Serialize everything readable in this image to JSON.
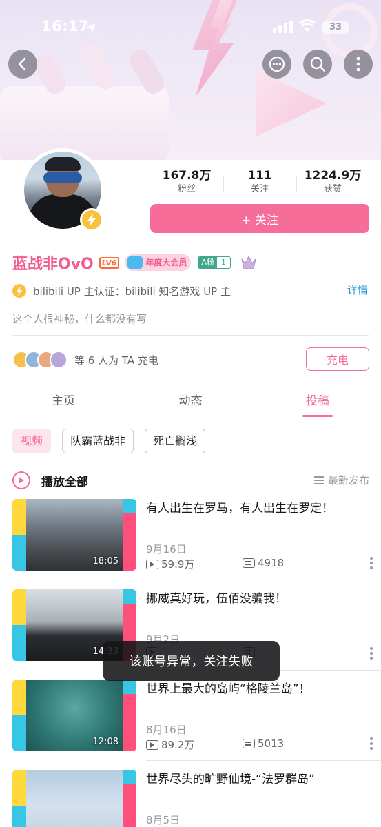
{
  "status_bar": {
    "time": "16:17",
    "battery": "33"
  },
  "profile": {
    "name": "蓝战非OvO",
    "level": "LV6",
    "vip_label": "年度大会员",
    "fan_medal": {
      "name": "A粉",
      "level": "1"
    },
    "auth": "bilibili UP 主认证：bilibili 知名游戏 UP 主",
    "detail_link": "详情",
    "sign": "这个人很神秘，什么都没有写",
    "charge_text": "等 6 人为 TA 充电",
    "charge_button": "充电",
    "follow_button": "+ 关注"
  },
  "stats": [
    {
      "num": "167.8万",
      "label": "粉丝"
    },
    {
      "num": "111",
      "label": "关注"
    },
    {
      "num": "1224.9万",
      "label": "获赞"
    }
  ],
  "tabs": [
    {
      "label": "主页"
    },
    {
      "label": "动态"
    },
    {
      "label": "投稿"
    }
  ],
  "chips": [
    {
      "label": "视频"
    },
    {
      "label": "队霸蓝战非"
    },
    {
      "label": "死亡搁浅"
    }
  ],
  "list_header": {
    "play_all": "播放全部",
    "sort": "最新发布"
  },
  "videos": [
    {
      "title": "有人出生在罗马，有人出生在罗定！",
      "duration": "18:05",
      "date": "9月16日",
      "views": "59.9万",
      "danmaku": "4918"
    },
    {
      "title": "挪威真好玩，伍佰没骗我！",
      "duration": "14:33",
      "date": "9月2日",
      "views": "",
      "danmaku": ""
    },
    {
      "title": "世界上最大的岛屿“格陵兰岛”！",
      "duration": "12:08",
      "date": "8月16日",
      "views": "89.2万",
      "danmaku": "5013"
    },
    {
      "title": "世界尽头的旷野仙境-“法罗群岛”",
      "duration": "",
      "date": "8月5日",
      "views": "",
      "danmaku": ""
    }
  ],
  "toast": "该账号异常，关注失败",
  "colors": {
    "accent": "#f66d99",
    "name": "#f15e8e",
    "link": "#1e9ad6"
  }
}
